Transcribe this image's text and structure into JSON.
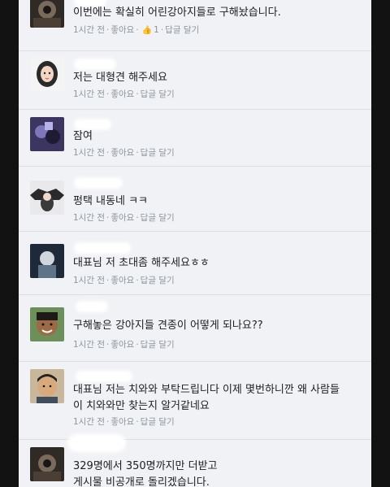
{
  "comments": [
    {
      "text": "이번에는 확실히 어린강아지들로 구해놨습니다.",
      "time": "1시간 전",
      "like": "좋아요",
      "reaction_count": "1",
      "reply": "답글 달기"
    },
    {
      "text": "저는 대형견 해주세요",
      "time": "1시간 전",
      "like": "좋아요",
      "reply": "답글 달기"
    },
    {
      "text": "잠여",
      "time": "1시간 전",
      "like": "좋아요",
      "reply": "답글 달기"
    },
    {
      "text": "펑택 내동네 ㅋㅋ",
      "time": "1시간 전",
      "like": "좋아요",
      "reply": "답글 달기"
    },
    {
      "text": "대표님 저 초대좀 해주세요ㅎㅎ",
      "time": "1시간 전",
      "like": "좋아요",
      "reply": "답글 달기"
    },
    {
      "text": "구해놓은 강아지들 견종이 어떻게 되나요??",
      "time": "1시간 전",
      "like": "좋아요",
      "reply": "답글 달기"
    },
    {
      "text": "대표님 저는 치와와 부탁드립니다 이제 몇번하니깐 왜 사람들\n이 치와와만 찾는지 알거같네요",
      "time": "1시간 전",
      "like": "좋아요",
      "reply": "답글 달기"
    },
    {
      "text": "329명에서 350명까지만 더받고\n게시물 비공개로 돌리겠습니다.",
      "time": "",
      "like": "",
      "reply": ""
    }
  ],
  "icons": {
    "like": "thumbs-up-icon"
  },
  "colors": {
    "background": "#f1f2f5",
    "text": "#1c1e21",
    "meta": "#8d949e",
    "like_blue": "#4a6fb5"
  }
}
